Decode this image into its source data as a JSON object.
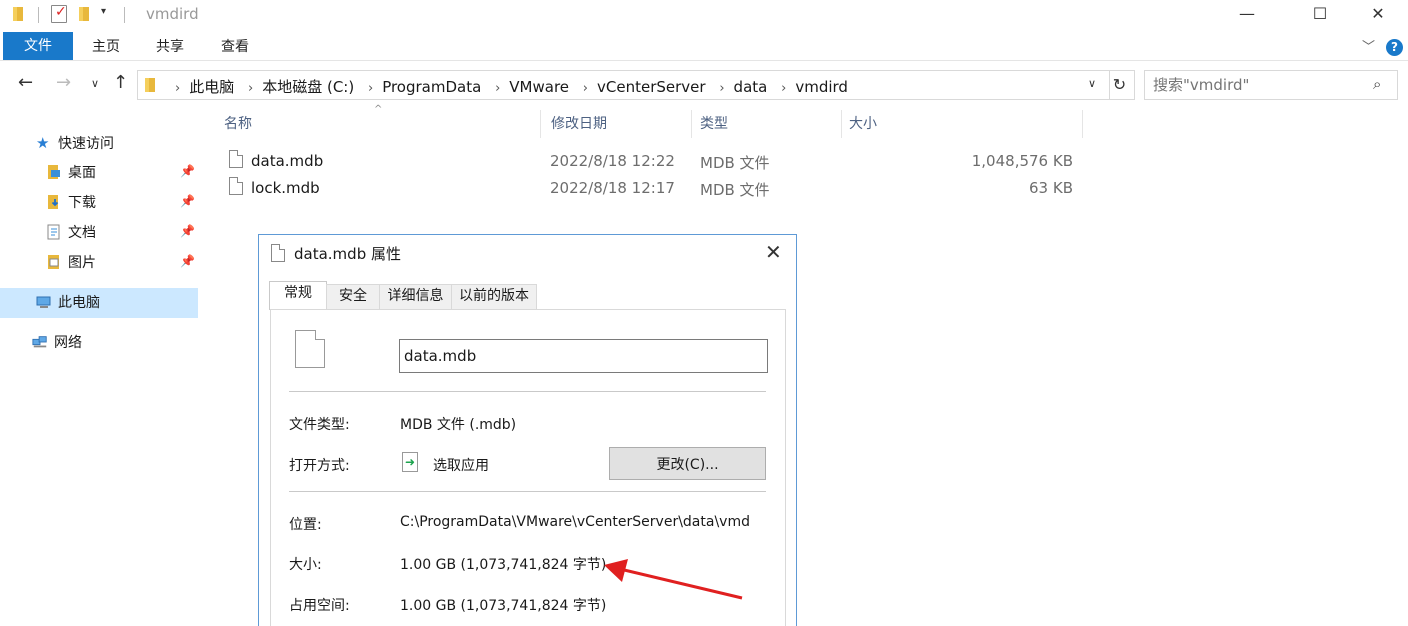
{
  "window": {
    "title": "vmdird",
    "minimize": "—",
    "maximize": "☐",
    "close": "✕"
  },
  "ribbon": {
    "tabs": [
      "文件",
      "主页",
      "共享",
      "查看"
    ],
    "help": "?",
    "expand": "﹀"
  },
  "address": {
    "crumbs": [
      "此电脑",
      "本地磁盘 (C:)",
      "ProgramData",
      "VMware",
      "vCenterServer",
      "data",
      "vmdird"
    ],
    "refresh": "↻"
  },
  "search": {
    "placeholder": "搜索\"vmdird\""
  },
  "sidebar": {
    "quick_access": "快速访问",
    "items": [
      {
        "label": "桌面",
        "pinned": true
      },
      {
        "label": "下载",
        "pinned": true
      },
      {
        "label": "文档",
        "pinned": true
      },
      {
        "label": "图片",
        "pinned": true
      }
    ],
    "this_pc": "此电脑",
    "network": "网络"
  },
  "file_list": {
    "columns": [
      "名称",
      "修改日期",
      "类型",
      "大小"
    ],
    "rows": [
      {
        "name": "data.mdb",
        "modified": "2022/8/18 12:22",
        "type": "MDB 文件",
        "size": "1,048,576 KB"
      },
      {
        "name": "lock.mdb",
        "modified": "2022/8/18 12:17",
        "type": "MDB 文件",
        "size": "63 KB"
      }
    ]
  },
  "dialog": {
    "title": "data.mdb 属性",
    "close": "✕",
    "tabs": [
      "常规",
      "安全",
      "详细信息",
      "以前的版本"
    ],
    "filename": "data.mdb",
    "file_type_label": "文件类型:",
    "file_type_value": "MDB 文件 (.mdb)",
    "open_with_label": "打开方式:",
    "open_with_value": "选取应用",
    "change_button": "更改(C)...",
    "location_label": "位置:",
    "location_value": "C:\\ProgramData\\VMware\\vCenterServer\\data\\vmd",
    "size_label": "大小:",
    "size_value": "1.00 GB (1,073,741,824 字节)",
    "disk_size_label": "占用空间:",
    "disk_size_value": "1.00 GB (1,073,741,824 字节)"
  },
  "colors": {
    "accent": "#1979ca",
    "selection": "#cce8ff",
    "annotation_arrow": "#e02020"
  }
}
